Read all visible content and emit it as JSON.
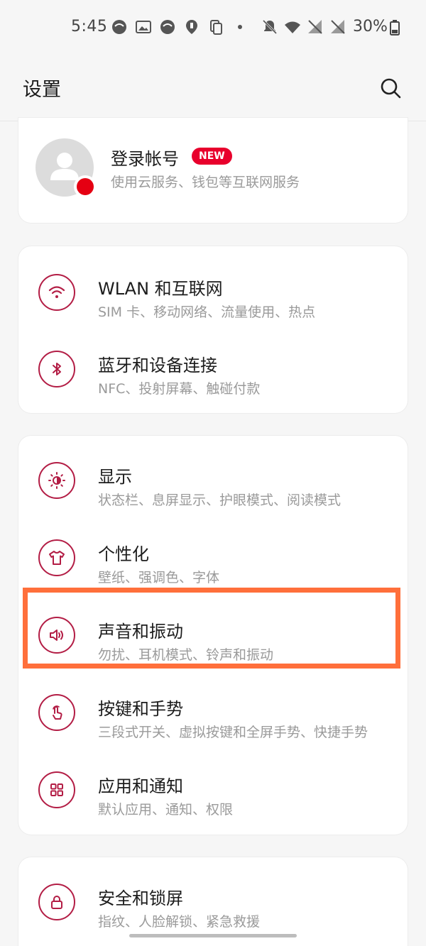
{
  "status_bar": {
    "time": "5:45",
    "battery": "30%"
  },
  "header": {
    "title": "设置"
  },
  "account": {
    "title": "登录帐号",
    "badge": "NEW",
    "subtitle": "使用云服务、钱包等互联网服务"
  },
  "sections": {
    "network": [
      {
        "title": "WLAN 和互联网",
        "subtitle": "SIM 卡、移动网络、流量使用、热点"
      },
      {
        "title": "蓝牙和设备连接",
        "subtitle": "NFC、投射屏幕、触碰付款"
      }
    ],
    "display": [
      {
        "title": "显示",
        "subtitle": "状态栏、息屏显示、护眼模式、阅读模式"
      },
      {
        "title": "个性化",
        "subtitle": "壁纸、强调色、字体"
      },
      {
        "title": "声音和振动",
        "subtitle": "勿扰、耳机模式、铃声和振动"
      },
      {
        "title": "按键和手势",
        "subtitle": "三段式开关、虚拟按键和全屏手势、快捷手势"
      },
      {
        "title": "应用和通知",
        "subtitle": "默认应用、通知、权限"
      }
    ],
    "security": [
      {
        "title": "安全和锁屏",
        "subtitle": "指纹、人脸解锁、紧急救援"
      }
    ]
  },
  "colors": {
    "accent": "#b31d45",
    "badge": "#e8002c",
    "highlight": "#ff6f3b"
  }
}
